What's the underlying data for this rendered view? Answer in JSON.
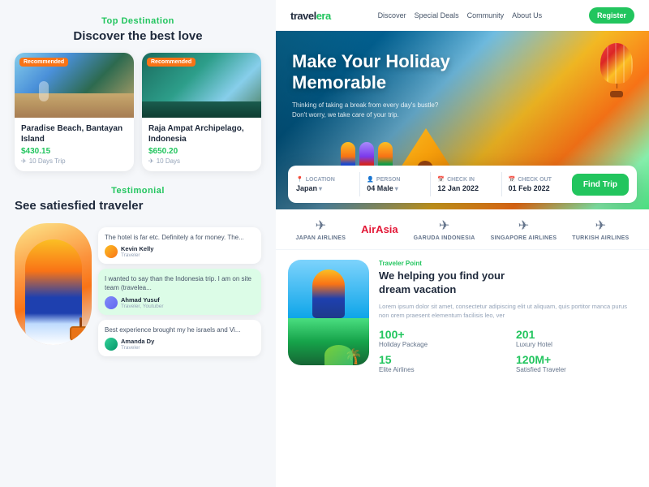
{
  "left": {
    "top_destination": {
      "section_label": "Top Destination",
      "section_title": "Discover the best love",
      "cards": [
        {
          "name": "Paradise Beach, Bantayan Island",
          "price": "$430.15",
          "days": "10 Days Trip",
          "recommended": true
        },
        {
          "name": "Raja Ampat Archipelago, Indonesia",
          "price": "$650.20",
          "days": "10 Days",
          "recommended": true
        }
      ]
    },
    "testimonial": {
      "section_label": "Testimonial",
      "section_title": "See satiesfied traveler",
      "chats": [
        {
          "text": "The hotel is far etc. Definitely a for money. The...",
          "author": "Kevin Kelly",
          "role": "Traveler"
        },
        {
          "text": "I wanted to say than the Indonesia trip. I am on site team (travelea...",
          "author": "Ahmad Yusuf",
          "role": "Traveler, Youtuber"
        },
        {
          "text": "Best experience brought my he israels and Vi...",
          "author": "Amanda Dy",
          "role": "Traveler"
        }
      ]
    }
  },
  "right": {
    "navbar": {
      "logo": "travelera",
      "links": [
        "Discover",
        "Special Deals",
        "Community",
        "About Us"
      ],
      "register_label": "Register"
    },
    "hero": {
      "title_line1": "Make Your Holiday",
      "title_line2": "Memorable",
      "subtitle": "Thinking of taking a break from every day's bustle? Don't worry, we take care of your trip."
    },
    "search": {
      "location_label": "LOCATION",
      "location_value": "Japan",
      "person_label": "PERSON",
      "person_value": "04 Male",
      "checkin_label": "CHECK IN",
      "checkin_value": "12 Jan 2022",
      "checkout_label": "CHECK OUT",
      "checkout_value": "01 Feb 2022",
      "button_label": "Find Trip"
    },
    "airlines": [
      {
        "name": "JAPAN AIRLINES",
        "icon": "✈"
      },
      {
        "name": "AirAsia",
        "icon": "✈"
      },
      {
        "name": "Garuda Indonesia",
        "icon": "✈"
      },
      {
        "name": "SINGAPORE AIRLINES",
        "icon": "✈"
      },
      {
        "name": "TURKISH AIRLINES",
        "icon": "✈"
      }
    ],
    "bottom": {
      "traveler_point": "Traveler Point",
      "title_line1": "We helping you find your",
      "title_line2": "dream vacation",
      "description": "Lorem ipsum dolor sit amet, consectetur adipiscing elit ut aliquam, quis portitor manca purus non orem praesent elementum facilisis leo, ver",
      "stats": [
        {
          "number": "100+",
          "label": "Holiday Package"
        },
        {
          "number": "201",
          "label": "Luxury Hotel"
        },
        {
          "number": "15",
          "label": "Elite Airlines"
        },
        {
          "number": "120M+",
          "label": "Satisfied Traveler"
        }
      ]
    }
  }
}
